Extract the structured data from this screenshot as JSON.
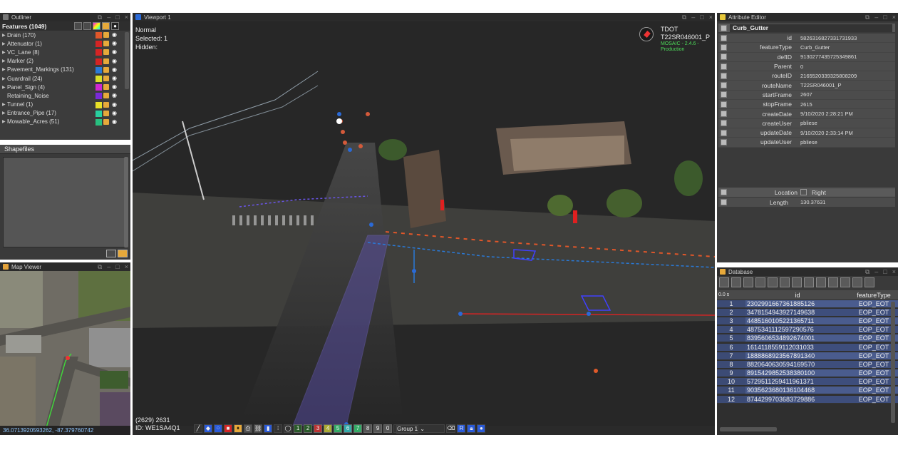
{
  "outliner": {
    "title": "Outliner",
    "header": "Features (1049)",
    "items": [
      {
        "label": "Drain (170)",
        "color": "#e0572a",
        "arrow": true
      },
      {
        "label": "Attenuator (1)",
        "color": "#d42424",
        "arrow": true
      },
      {
        "label": "VC_Lane (8)",
        "color": "#d42424",
        "arrow": true
      },
      {
        "label": "Marker (2)",
        "color": "#d42424",
        "arrow": true
      },
      {
        "label": "Pavement_Markings (131)",
        "color": "#2a7ad8",
        "arrow": true
      },
      {
        "label": "Guardrail (24)",
        "color": "#d9e028",
        "arrow": true
      },
      {
        "label": "Panel_Sign (4)",
        "color": "#d028d0",
        "arrow": true
      },
      {
        "label": "Retaining_Noise",
        "color": "#7a2ad8",
        "arrow": false
      },
      {
        "label": "Tunnel (1)",
        "color": "#e8e028",
        "arrow": true
      },
      {
        "label": "Entrance_Pipe (17)",
        "color": "#28d0a0",
        "arrow": true
      },
      {
        "label": "Mowable_Acres (51)",
        "color": "#28c080",
        "arrow": true
      }
    ]
  },
  "shapefiles": {
    "title": "Shapefiles"
  },
  "mapviewer": {
    "title": "Map Viewer",
    "coords": "36.0713920593262, -87.379760742"
  },
  "viewport": {
    "title": "Viewport 1",
    "mode": "Normal",
    "selected": "Selected: 1",
    "hidden": "Hidden:",
    "org": "TDOT",
    "route": "T22SR046001_P",
    "version": "MOSAIC - 2.4.6 -",
    "build": "Production",
    "frame": "(2629) 2631",
    "frame_id": "ID: WE1SA4Q1",
    "group": "Group 1",
    "group_nums": [
      "1",
      "2",
      "3",
      "4",
      "5",
      "6",
      "7",
      "8",
      "9",
      "0"
    ]
  },
  "attribute_editor": {
    "title": "Attribute Editor",
    "selected": "Curb_Gutter",
    "rows": [
      {
        "k": "id",
        "v": "5826316827331731933"
      },
      {
        "k": "featureType",
        "v": "Curb_Gutter"
      },
      {
        "k": "defID",
        "v": "9130277435725349861"
      },
      {
        "k": "Parent",
        "v": "0"
      },
      {
        "k": "routeID",
        "v": "2165520339325808209"
      },
      {
        "k": "routeName",
        "v": "T22SR046001_P"
      },
      {
        "k": "startFrame",
        "v": "2607"
      },
      {
        "k": "stopFrame",
        "v": "2615"
      },
      {
        "k": "createDate",
        "v": "9/10/2020 2:28:21 PM"
      },
      {
        "k": "createUser",
        "v": "pbliese"
      },
      {
        "k": "updateDate",
        "v": "9/10/2020 2:33:14 PM"
      },
      {
        "k": "updateUser",
        "v": "pbliese"
      }
    ],
    "location_label": "Location",
    "location_value": "Right",
    "length_label": "Length",
    "length_value": "130.37631"
  },
  "database": {
    "title": "Database",
    "col_id": "id",
    "col_type": "featureType",
    "rows": [
      {
        "n": "1",
        "id": "2302991667361885126",
        "ft": "EOP_EOT"
      },
      {
        "n": "2",
        "id": "3478154943927149638",
        "ft": "EOP_EOT"
      },
      {
        "n": "3",
        "id": "4485160105221365711",
        "ft": "EOP_EOT"
      },
      {
        "n": "4",
        "id": "4875341112597290576",
        "ft": "EOP_EOT"
      },
      {
        "n": "5",
        "id": "8395606534892674001",
        "ft": "EOP_EOT"
      },
      {
        "n": "6",
        "id": "1614118559112031033",
        "ft": "EOP_EOT"
      },
      {
        "n": "7",
        "id": "1888868923567891340",
        "ft": "EOP_EOT"
      },
      {
        "n": "8",
        "id": "8820640630594169570",
        "ft": "EOP_EOT"
      },
      {
        "n": "9",
        "id": "8915429852538380100",
        "ft": "EOP_EOT"
      },
      {
        "n": "10",
        "id": "5729511259411961371",
        "ft": "EOP_EOT"
      },
      {
        "n": "11",
        "id": "9035623680136104468",
        "ft": "EOP_EOT"
      },
      {
        "n": "12",
        "id": "8744299703683729886",
        "ft": "EOP_EOT"
      }
    ]
  }
}
